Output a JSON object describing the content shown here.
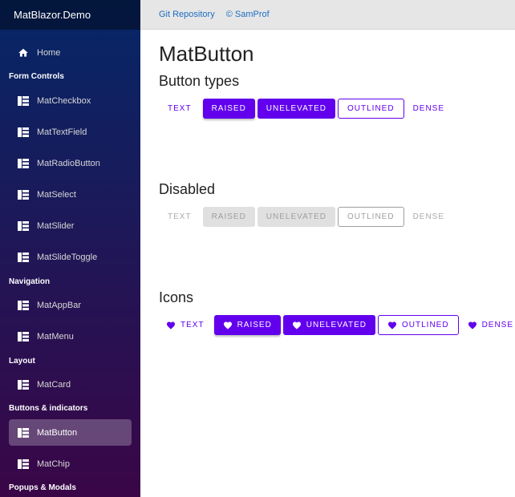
{
  "app": {
    "brand": "MatBlazor.Demo"
  },
  "topbar": {
    "links": [
      "Git Repository",
      "© SamProf"
    ]
  },
  "sidebar": {
    "home": "Home",
    "sections": [
      "Form Controls",
      "Navigation",
      "Layout",
      "Buttons & indicators",
      "Popups & Modals"
    ],
    "items": [
      "MatCheckbox",
      "MatTextField",
      "MatRadioButton",
      "MatSelect",
      "MatSlider",
      "MatSlideToggle",
      "MatAppBar",
      "MatMenu",
      "MatCard",
      "MatButton",
      "MatChip"
    ]
  },
  "page": {
    "title": "MatButton",
    "sections": [
      "Button types",
      "Disabled",
      "Icons"
    ],
    "buttons": [
      "TEXT",
      "RAISED",
      "UNELEVATED",
      "OUTLINED",
      "DENSE"
    ]
  },
  "colors": {
    "accent": "#6200ee",
    "link": "#1b6ec2"
  }
}
